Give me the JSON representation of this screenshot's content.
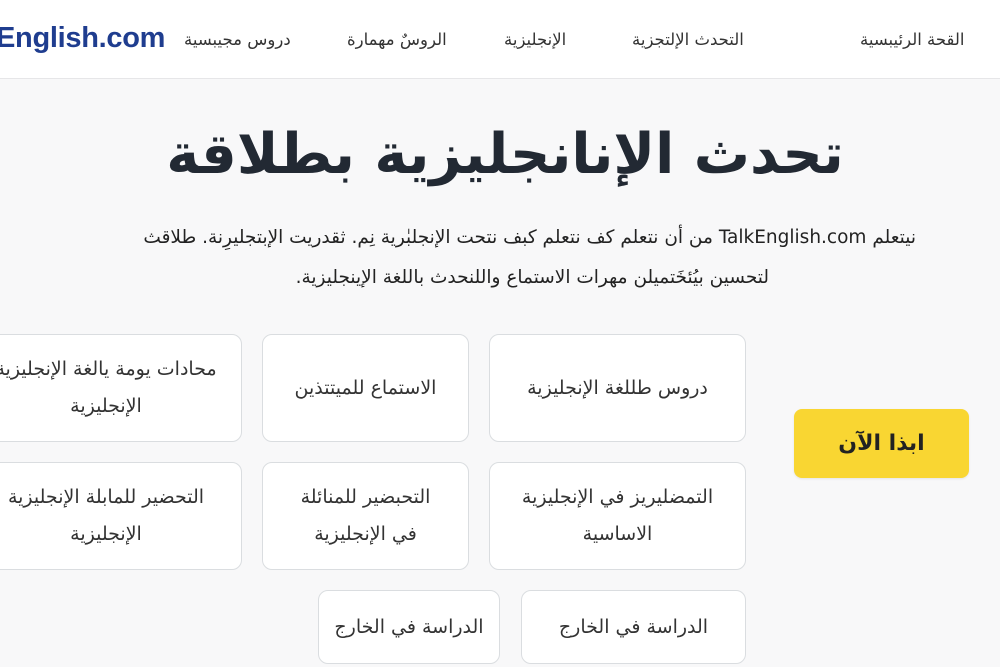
{
  "header": {
    "logo_text": "English.com",
    "nav": [
      "القحة الرئيبسية",
      "التحدث الإلتجزية",
      "الإنجليزية",
      "الروسٌ مهمارة",
      "دروس مجيبسية"
    ]
  },
  "hero": {
    "title": "تحدث الإنانجليزية بطلاقة",
    "description_line1": "نيتعلم TalkEnglish.com من أن نتعلم كف نتعلم كبف نتحت الإنجلبٰرية نِم. ثقدريت الإبتجليرِنة. طلاقث",
    "description_line2": "لتحسين بيُئخَتميلن مهرات الاستماع واللنحدث باللغة الإينجليزية."
  },
  "cards": [
    {
      "label": "دروس طللغة الإنجليزية"
    },
    {
      "label": "الاستماع للميتتذين"
    },
    {
      "label": "محادات يومة يالغة الإنجليزية\nالإنجليزية"
    },
    {
      "label": "التمضليريز في الإنجليزية\nالاساسية"
    },
    {
      "label": "التحبضير للمنائلة\nفي الإنجليزية"
    },
    {
      "label": "التحضير للمابلة الإنجليزية\nالإنجليزية"
    },
    {
      "label": "الدراسة في الخارج"
    },
    {
      "label": "الدراسة في الخارج"
    }
  ],
  "cta": {
    "label": "ابذا الآن"
  },
  "colors": {
    "brand": "#1f3d8f",
    "cta": "#f9d632"
  }
}
